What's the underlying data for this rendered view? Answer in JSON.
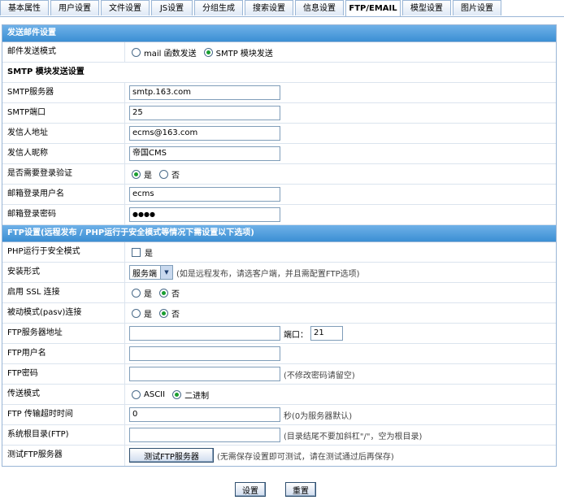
{
  "tabs": [
    "基本属性",
    "用户设置",
    "文件设置",
    "JS设置",
    "分组生成",
    "搜索设置",
    "信息设置",
    "FTP/EMAIL",
    "模型设置",
    "图片设置"
  ],
  "active_tab": "FTP/EMAIL",
  "mail": {
    "header": "发送邮件设置",
    "mode_label": "邮件发送模式",
    "mode_opt1": "mail 函数发送",
    "mode_opt2": "SMTP 模块发送",
    "smtp_header": "SMTP 模块发送设置",
    "server_label": "SMTP服务器",
    "server_value": "smtp.163.com",
    "port_label": "SMTP端口",
    "port_value": "25",
    "from_label": "发信人地址",
    "from_value": "ecms@163.com",
    "nick_label": "发信人昵称",
    "nick_value": "帝国CMS",
    "auth_label": "是否需要登录验证",
    "yes": "是",
    "no": "否",
    "user_label": "邮箱登录用户名",
    "user_value": "ecms",
    "pass_label": "邮箱登录密码",
    "pass_value": "●●●●"
  },
  "ftp": {
    "header": "FTP设置(远程发布 / PHP运行于安全模式等情况下需设置以下选项)",
    "safemode_label": "PHP运行于安全模式",
    "safemode_yes": "是",
    "install_label": "安装形式",
    "install_value": "服务端",
    "install_note": "(如是远程发布，请选客户端，并且需配置FTP选项)",
    "ssl_label": "启用 SSL 连接",
    "pasv_label": "被动模式(pasv)连接",
    "yes": "是",
    "no": "否",
    "host_label": "FTP服务器地址",
    "host_value": "",
    "port_label": "端口：",
    "port_value": "21",
    "user_label": "FTP用户名",
    "user_value": "",
    "pass_label": "FTP密码",
    "pass_value": "",
    "pass_note": "(不修改密码请留空)",
    "transfer_label": "传送模式",
    "transfer_opt1": "ASCII",
    "transfer_opt2": "二进制",
    "timeout_label": "FTP 传输超时时间",
    "timeout_value": "0",
    "timeout_note": "秒(0为服务器默认)",
    "root_label": "系统根目录(FTP)",
    "root_value": "",
    "root_note": "(目录结尾不要加斜杠\"/\"，空为根目录)",
    "test_label": "测试FTP服务器",
    "test_button": "测试FTP服务器",
    "test_note": "(无需保存设置即可测试，请在测试通过后再保存)"
  },
  "buttons": {
    "submit": "设置",
    "reset": "重置"
  }
}
